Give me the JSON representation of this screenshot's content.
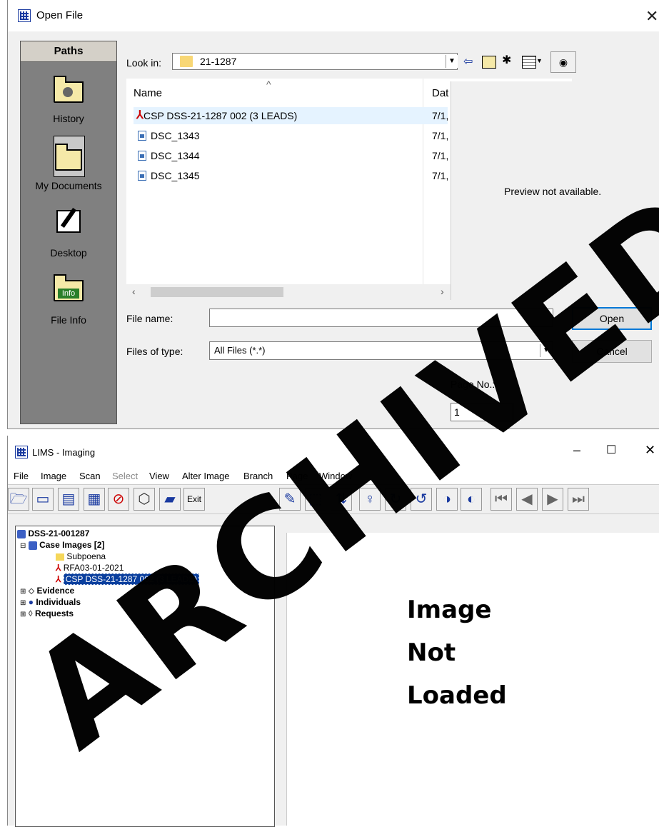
{
  "dialog": {
    "title": "Open File",
    "close": "✕",
    "paths_header": "Paths",
    "paths": [
      {
        "label": "History",
        "icon": "history-icon"
      },
      {
        "label": "My Documents",
        "icon": "folder-icon"
      },
      {
        "label": "Desktop",
        "icon": "desktop-icon"
      },
      {
        "label": "File Info",
        "icon": "info-icon"
      }
    ],
    "look_in_label": "Look in:",
    "look_in_value": "21-1287",
    "columns": {
      "name": "Name",
      "date": "Dat"
    },
    "files": [
      {
        "name": "CSP DSS-21-1287 002 (3 LEADS)",
        "date": "7/1,",
        "type": "pdf"
      },
      {
        "name": "DSC_1343",
        "date": "7/1,",
        "type": "image"
      },
      {
        "name": "DSC_1344",
        "date": "7/1,",
        "type": "image"
      },
      {
        "name": "DSC_1345",
        "date": "7/1,",
        "type": "image"
      }
    ],
    "preview_text": "Preview not available.",
    "file_name_label": "File name:",
    "file_name_value": "",
    "files_of_type_label": "Files of type:",
    "files_of_type_value": "All Files (*.*)",
    "open_button": "Open",
    "cancel_button": "Cancel",
    "page_no_label": "Page No.:",
    "page_no_value": "1"
  },
  "lims": {
    "title": "LIMS - Imaging",
    "window_controls": {
      "minimize": "–",
      "maximize": "☐",
      "close": "✕"
    },
    "menu": [
      "File",
      "Image",
      "Scan",
      "Select",
      "View",
      "Alter Image",
      "Branch",
      "Page",
      "Window"
    ],
    "toolbar": {
      "exit_label": "Exit"
    },
    "tree": {
      "root": "DSS-21-001287",
      "case_images": "Case Images [2]",
      "children": [
        "Subpoena",
        "RFA03-01-2021",
        "CSP DSS-21-1287 002 (3 LEADS)"
      ],
      "others": [
        "Evidence",
        "Individuals",
        "Requests"
      ]
    },
    "viewer_lines": [
      "Image",
      "Not",
      "Loaded"
    ]
  },
  "watermark": "ARCHIVED"
}
